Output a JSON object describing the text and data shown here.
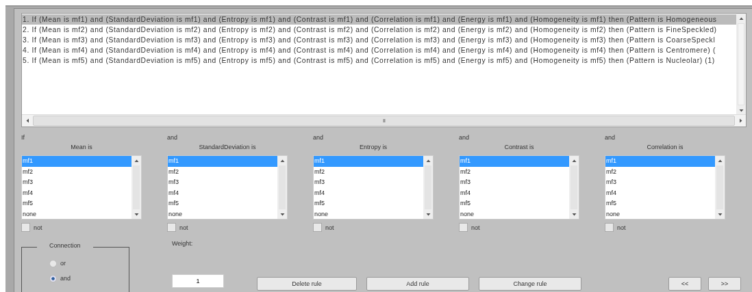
{
  "rules": {
    "items": [
      {
        "text": "1. If (Mean is mf1) and (StandardDeviation is mf1) and (Entropy is mf1) and (Contrast is mf1) and (Correlation is mf1) and (Energy is mf1) and (Homogeneity is mf1) then (Pattern is Homogeneous",
        "selected": true
      },
      {
        "text": "2. If (Mean is mf2) and (StandardDeviation is mf2) and (Entropy is mf2) and (Contrast is mf2) and (Correlation is mf2) and (Energy is mf2) and (Homogeneity is mf2) then (Pattern is FineSpeckled)",
        "selected": false
      },
      {
        "text": "3. If (Mean is mf3) and (StandardDeviation is mf3) and (Entropy is mf3) and (Contrast is mf3) and (Correlation is mf3) and (Energy is mf3) and (Homogeneity is mf3) then (Pattern is CoarseSpeckl",
        "selected": false
      },
      {
        "text": "4. If (Mean is mf4) and (StandardDeviation is mf4) and (Entropy is mf4) and (Contrast is mf4) and (Correlation is mf4) and (Energy is mf4) and (Homogeneity is mf4) then (Pattern is Centromere) (",
        "selected": false
      },
      {
        "text": "5. If (Mean is mf5) and (StandardDeviation is mf5) and (Entropy is mf5) and (Contrast is mf5) and (Correlation is mf5) and (Energy is mf5) and (Homogeneity is mf5) then (Pattern is Nucleolar) (1)",
        "selected": false
      }
    ],
    "scroll_grip": "III"
  },
  "conditions": [
    {
      "connector": "If",
      "label": "Mean is",
      "options": [
        {
          "text": "mf1",
          "selected": true
        },
        {
          "text": "mf2",
          "selected": false
        },
        {
          "text": "mf3",
          "selected": false
        },
        {
          "text": "mf4",
          "selected": false
        },
        {
          "text": "mf5",
          "selected": false
        },
        {
          "text": "none",
          "selected": false
        }
      ],
      "not": {
        "label": "not",
        "checked": false
      }
    },
    {
      "connector": "and",
      "label": "StandardDeviation is",
      "options": [
        {
          "text": "mf1",
          "selected": true
        },
        {
          "text": "mf2",
          "selected": false
        },
        {
          "text": "mf3",
          "selected": false
        },
        {
          "text": "mf4",
          "selected": false
        },
        {
          "text": "mf5",
          "selected": false
        },
        {
          "text": "none",
          "selected": false
        }
      ],
      "not": {
        "label": "not",
        "checked": false
      }
    },
    {
      "connector": "and",
      "label": "Entropy is",
      "options": [
        {
          "text": "mf1",
          "selected": true
        },
        {
          "text": "mf2",
          "selected": false
        },
        {
          "text": "mf3",
          "selected": false
        },
        {
          "text": "mf4",
          "selected": false
        },
        {
          "text": "mf5",
          "selected": false
        },
        {
          "text": "none",
          "selected": false
        }
      ],
      "not": {
        "label": "not",
        "checked": false
      }
    },
    {
      "connector": "and",
      "label": "Contrast is",
      "options": [
        {
          "text": "mf1",
          "selected": true
        },
        {
          "text": "mf2",
          "selected": false
        },
        {
          "text": "mf3",
          "selected": false
        },
        {
          "text": "mf4",
          "selected": false
        },
        {
          "text": "mf5",
          "selected": false
        },
        {
          "text": "none",
          "selected": false
        }
      ],
      "not": {
        "label": "not",
        "checked": false
      }
    },
    {
      "connector": "and",
      "label": "Correlation is",
      "options": [
        {
          "text": "mf1",
          "selected": true
        },
        {
          "text": "mf2",
          "selected": false
        },
        {
          "text": "mf3",
          "selected": false
        },
        {
          "text": "mf4",
          "selected": false
        },
        {
          "text": "mf5",
          "selected": false
        },
        {
          "text": "none",
          "selected": false
        }
      ],
      "not": {
        "label": "not",
        "checked": false
      }
    }
  ],
  "connection": {
    "title": "Connection",
    "options": [
      {
        "label": "or",
        "selected": false
      },
      {
        "label": "and",
        "selected": true
      }
    ]
  },
  "weight": {
    "label": "Weight:",
    "value": "1"
  },
  "buttons": [
    {
      "label": "Delete rule"
    },
    {
      "label": "Add rule"
    },
    {
      "label": "Change rule"
    }
  ],
  "nav_buttons": [
    {
      "label": "<<"
    },
    {
      "label": ">>"
    }
  ]
}
